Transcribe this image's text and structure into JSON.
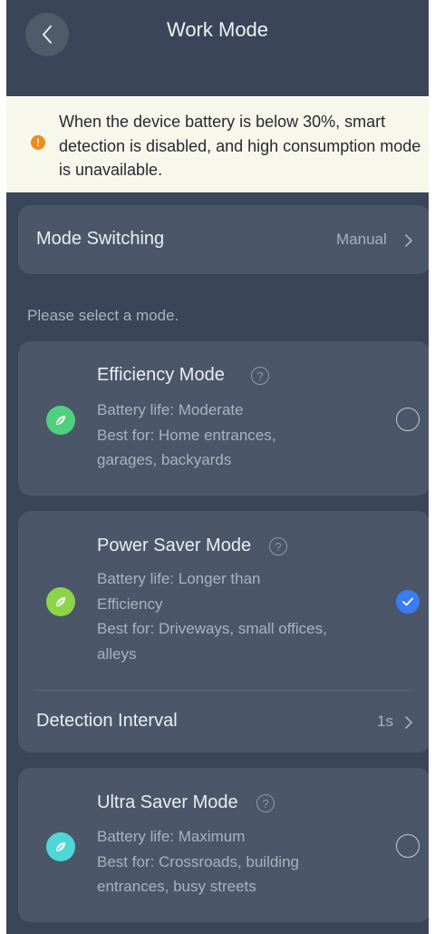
{
  "header": {
    "title": "Work Mode"
  },
  "warning": {
    "text": "When the device battery is below 30%, smart detection is disabled, and high consumption mode is unavailable.",
    "icon": "exclamation-icon"
  },
  "mode_switching": {
    "label": "Mode Switching",
    "value": "Manual"
  },
  "hint": "Please select a mode.",
  "modes": [
    {
      "title": "Efficiency Mode",
      "battery": "Battery life: Moderate",
      "best_for": "Best for: Home entrances, garages, backyards",
      "selected": false,
      "icon_color": "#4fd07f"
    },
    {
      "title": "Power Saver Mode",
      "battery": "Battery life: Longer than Efficiency",
      "best_for": "Best for: Driveways, small offices, alleys",
      "selected": true,
      "icon_color": "#8ed44a"
    },
    {
      "title": "Ultra Saver Mode",
      "battery": "Battery life: Maximum",
      "best_for": "Best for: Crossroads, building entrances, busy streets",
      "selected": false,
      "icon_color": "#4fd6d6"
    }
  ],
  "detection_interval": {
    "label": "Detection Interval",
    "value": "1s"
  },
  "colors": {
    "accent": "#3a7cf5",
    "warning": "#f08a18",
    "background": "#3a4559",
    "card": "#4b5769"
  }
}
